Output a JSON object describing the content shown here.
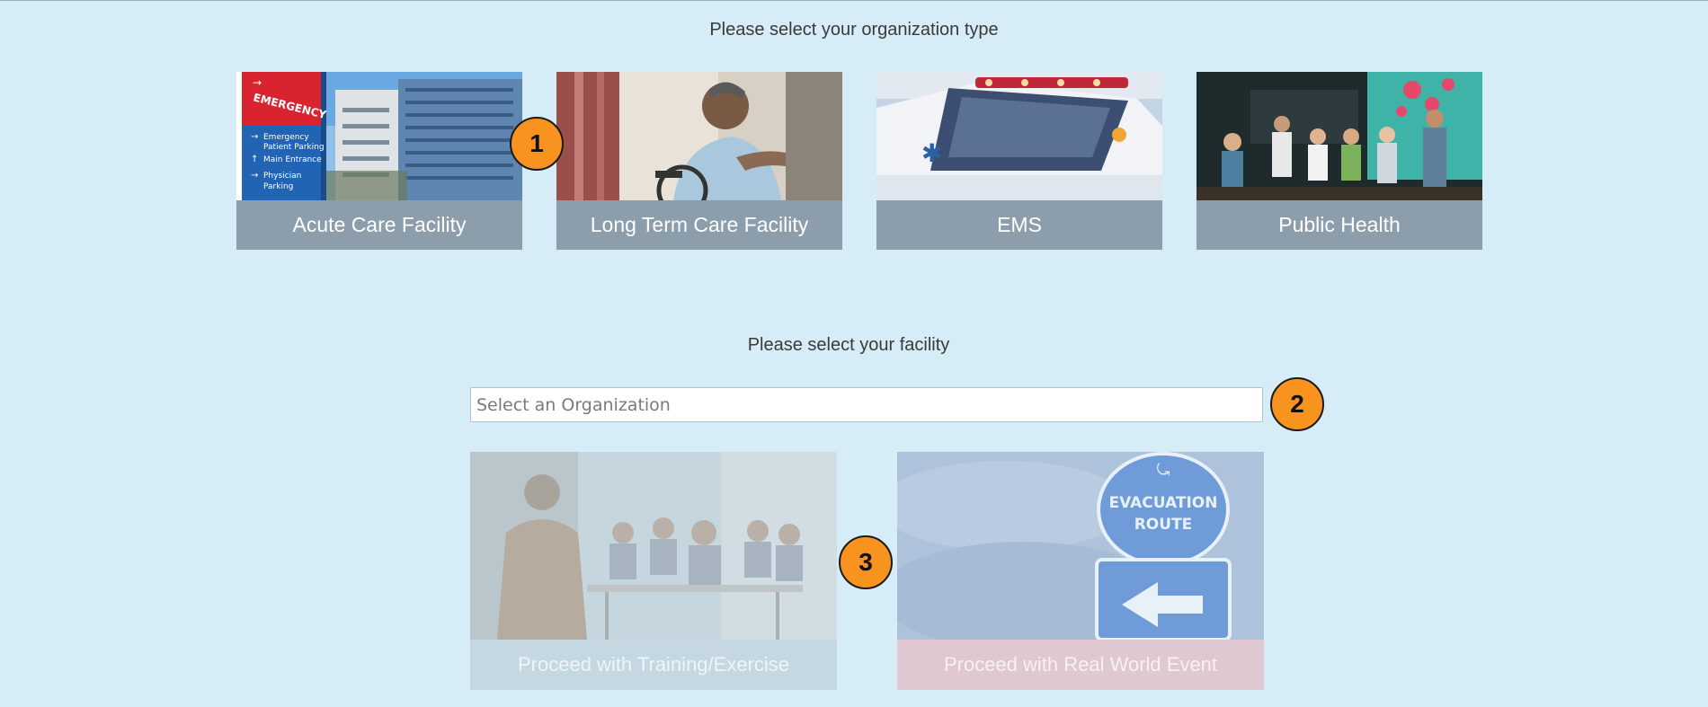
{
  "org_type": {
    "heading": "Please select your organization type",
    "cards": [
      {
        "label": "Acute Care Facility"
      },
      {
        "label": "Long Term Care Facility"
      },
      {
        "label": "EMS"
      },
      {
        "label": "Public Health"
      }
    ]
  },
  "hospital_sign": {
    "title": "EMERGENCY",
    "lines": [
      "Emergency",
      "Patient Parking",
      "Main Entrance",
      "Physician",
      "Parking"
    ]
  },
  "facility": {
    "heading": "Please select your facility",
    "select_placeholder": "Select an Organization"
  },
  "proceed": {
    "training_label": "Proceed with Training/Exercise",
    "real_label": "Proceed with Real World Event"
  },
  "evacuation_sign": {
    "line1": "EVACUATION",
    "line2": "ROUTE"
  },
  "badges": [
    "1",
    "2",
    "3"
  ],
  "colors": {
    "page_background": "#d6ecf6",
    "card_label": "#8c9eab",
    "badge": "#f7931e",
    "training_label_disabled": "#c5d8e1",
    "real_label_disabled": "#dfc8d2"
  }
}
